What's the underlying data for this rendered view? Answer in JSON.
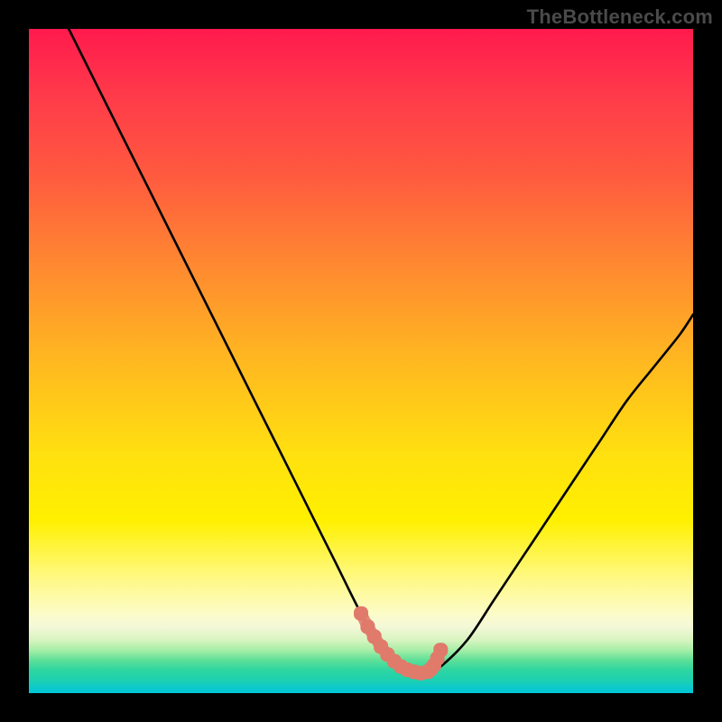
{
  "brand": {
    "label": "TheBottleneck.com"
  },
  "colors": {
    "background": "#000000",
    "curve": "#000000",
    "marker": "#e07a6a",
    "gradient_stops": [
      "#ff1a4d",
      "#ff3a4a",
      "#ff5a3f",
      "#ff8a30",
      "#ffb820",
      "#ffe010",
      "#fff000",
      "#fff87a",
      "#fcfcc8",
      "#f4f8d8",
      "#d8f4c0",
      "#a8eea8",
      "#5fe098",
      "#2fd6a0",
      "#1ed0b0",
      "#0fcac8",
      "#00c6d8"
    ]
  },
  "chart_data": {
    "type": "line",
    "title": "",
    "xlabel": "",
    "ylabel": "",
    "xlim": [
      0,
      100
    ],
    "ylim": [
      0,
      100
    ],
    "grid": false,
    "legend": false,
    "series": [
      {
        "name": "bottleneck-curve",
        "x": [
          6,
          10,
          14,
          18,
          22,
          26,
          30,
          34,
          38,
          42,
          46,
          50,
          52,
          54,
          56,
          58,
          60,
          62,
          66,
          70,
          74,
          78,
          82,
          86,
          90,
          94,
          98,
          100
        ],
        "y": [
          100,
          92,
          84,
          76,
          68,
          60,
          52,
          44,
          36,
          28,
          20,
          12,
          9,
          6,
          4,
          3,
          3,
          4,
          8,
          14,
          20,
          26,
          32,
          38,
          44,
          49,
          54,
          57
        ]
      }
    ],
    "markers": {
      "name": "highlight-dots",
      "x": [
        50,
        51,
        52,
        53,
        54,
        55,
        56,
        57,
        58,
        59,
        60,
        60.5,
        61,
        61.5,
        62
      ],
      "y": [
        12,
        10,
        8.5,
        7,
        5.8,
        4.8,
        4.0,
        3.5,
        3.2,
        3.0,
        3.2,
        3.6,
        4.2,
        5.2,
        6.5
      ]
    }
  }
}
